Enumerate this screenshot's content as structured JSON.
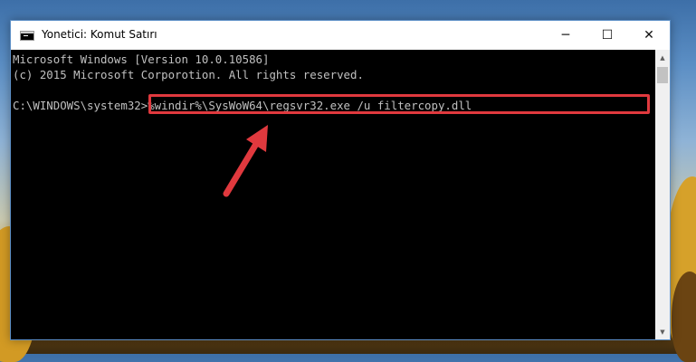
{
  "window": {
    "title": "Yonetici: Komut Satırı",
    "minimize_glyph": "─",
    "maximize_glyph": "☐",
    "close_glyph": "✕"
  },
  "console": {
    "lines": [
      "Microsoft Windows [Version 10.0.10586]",
      "(c) 2015 Microsoft Corporotion. All rights reserved.",
      "",
      "C:\\WINDOWS\\system32>%windir%\\SysWoW64\\regsvr32.exe /u filtercopy.dll"
    ],
    "prompt": "C:\\WINDOWS\\system32>",
    "command": "%windir%\\SysWoW64\\regsvr32.exe /u filtercopy.dll",
    "text_color": "#c0c0c0",
    "background": "#000000"
  },
  "annotation": {
    "highlight_color": "#e0393e",
    "arrow_color": "#e0393e"
  },
  "icons": {
    "app": "command-prompt-icon",
    "scroll_up": "scroll-up-arrow-icon",
    "scroll_down": "scroll-down-arrow-icon"
  }
}
